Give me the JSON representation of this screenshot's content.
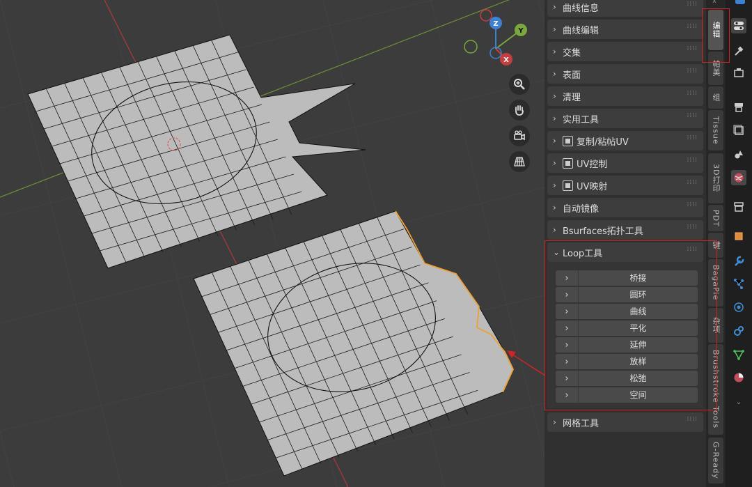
{
  "npanel": {
    "panels": [
      {
        "label": "曲线信息",
        "icon": null
      },
      {
        "label": "曲线编辑",
        "icon": null
      },
      {
        "label": "交集",
        "icon": null
      },
      {
        "label": "表面",
        "icon": null
      },
      {
        "label": "清理",
        "icon": null
      },
      {
        "label": "实用工具",
        "icon": null
      },
      {
        "label": "复制/粘帖UV",
        "icon": "uv-panel-icon"
      },
      {
        "label": "UV控制",
        "icon": "uv-panel-icon"
      },
      {
        "label": "UV映射",
        "icon": "uv-panel-icon"
      },
      {
        "label": "自动镜像",
        "icon": null
      },
      {
        "label": "Bsurfaces拓扑工具",
        "icon": null
      }
    ],
    "loop_tools": {
      "title": "Loop工具",
      "items": [
        "桥接",
        "圆环",
        "曲线",
        "平化",
        "延伸",
        "放样",
        "松弛",
        "空间"
      ]
    },
    "after": {
      "label": "网格工具"
    }
  },
  "vtabs": [
    "编辑",
    "帕美",
    "组",
    "Tissue",
    "3D打印",
    "PDT",
    "键",
    "BagaPie",
    "杂项",
    "Brushstroke Tools",
    "G-Ready"
  ],
  "gizmo": {
    "z": "Z",
    "y": "Y",
    "x": "X"
  },
  "nav_icons": [
    "zoom-icon",
    "pan-hand-icon",
    "camera-icon",
    "grid-perspective-icon"
  ],
  "colors": {
    "accent_red": "#d02424",
    "selected_edge": "#f0a030",
    "x_axis": "#c93d3d",
    "y_axis": "#7aa83a",
    "z_axis": "#3b82d6"
  },
  "top_edge_char": "x"
}
